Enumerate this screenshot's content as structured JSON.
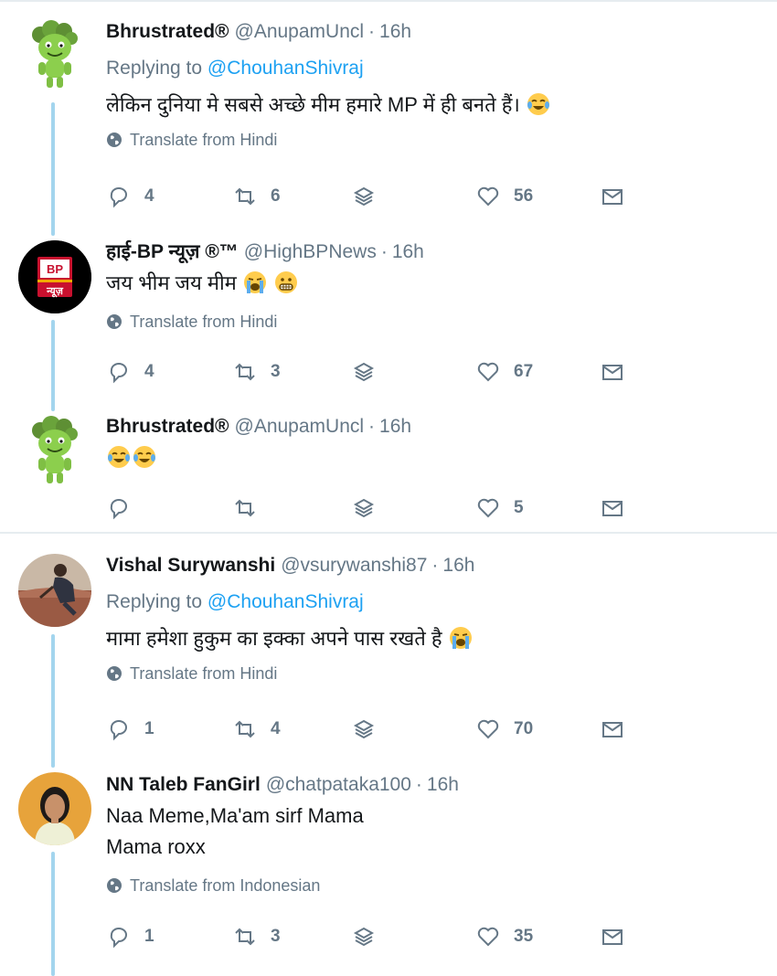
{
  "tweets": [
    {
      "name": "Bhrustrated®",
      "handle": "@AnupamUncl",
      "time": "16h",
      "replying_label": "Replying to",
      "replying_handle": "@ChouhanShivraj",
      "text": "लेकिन दुनिया मे सबसे अच्छे मीम हमारे MP में ही बनते हैं।",
      "translate": "Translate from Hindi",
      "replies": "4",
      "retweets": "6",
      "likes": "56",
      "avatar": "green-troll-avatar"
    },
    {
      "name": "हाई-BP न्यूज़ ®™",
      "handle": "@HighBPNews",
      "time": "16h",
      "text": "जय भीम जय मीम",
      "translate": "Translate from Hindi",
      "replies": "4",
      "retweets": "3",
      "likes": "67",
      "avatar": "bp-news-logo",
      "avatar_text_top": "BP",
      "avatar_text_bottom": "न्यूज़"
    },
    {
      "name": "Bhrustrated®",
      "handle": "@AnupamUncl",
      "time": "16h",
      "text": "",
      "replies": "",
      "retweets": "",
      "likes": "5",
      "avatar": "green-troll-avatar"
    },
    {
      "name": "Vishal Surywanshi",
      "handle": "@vsurywanshi87",
      "time": "16h",
      "replying_label": "Replying to",
      "replying_handle": "@ChouhanShivraj",
      "text": "मामा हमेशा हुकुम का इक्का अपने पास रखते है",
      "translate": "Translate from Hindi",
      "replies": "1",
      "retweets": "4",
      "likes": "70",
      "avatar": "photo-avatar"
    },
    {
      "name": "NN Taleb FanGirl",
      "handle": "@chatpataka100",
      "time": "16h",
      "text_line1": "Naa Meme,Ma'am sirf Mama",
      "text_line2": "Mama roxx",
      "translate": "Translate from Indonesian",
      "replies": "1",
      "retweets": "3",
      "likes": "35",
      "avatar": "photo-avatar"
    }
  ],
  "dot": "·",
  "colors": {
    "link": "#1da1f2",
    "secondary": "#657786",
    "thread_line": "#a3d5ee",
    "divider": "#e6ecf0"
  }
}
